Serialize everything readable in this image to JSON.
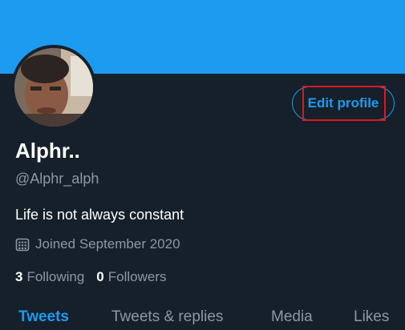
{
  "profile": {
    "edit_button_label": "Edit profile",
    "display_name": "Alphr..",
    "handle": "@Alphr_alph",
    "bio": "Life is not always constant",
    "joined": "Joined September 2020",
    "following_count": "3",
    "following_label": "Following",
    "followers_count": "0",
    "followers_label": "Followers"
  },
  "tabs": [
    {
      "label": "Tweets",
      "active": true
    },
    {
      "label": "Tweets & replies",
      "active": false
    },
    {
      "label": "Media",
      "active": false
    },
    {
      "label": "Likes",
      "active": false
    }
  ],
  "colors": {
    "background": "#15202b",
    "banner": "#1d9bf0",
    "accent": "#1d9bf0",
    "secondary_text": "#8b98a5",
    "highlight_box": "#e0161b"
  },
  "icons": {
    "joined": "calendar-icon"
  }
}
